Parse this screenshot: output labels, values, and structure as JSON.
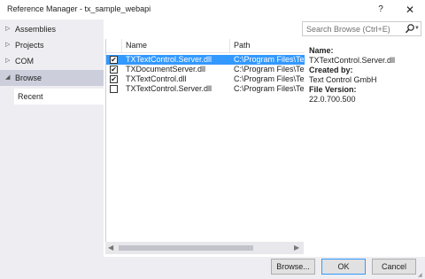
{
  "window": {
    "title": "Reference Manager - tx_sample_webapi",
    "help_label": "?",
    "close_label": "✕"
  },
  "sidebar": {
    "items": [
      {
        "label": "Assemblies",
        "arrow": "▷"
      },
      {
        "label": "Projects",
        "arrow": "▷"
      },
      {
        "label": "COM",
        "arrow": "▷"
      },
      {
        "label": "Browse",
        "arrow": "◢"
      }
    ],
    "subitems": [
      {
        "label": "Recent"
      }
    ]
  },
  "list": {
    "columns": [
      "Name",
      "Path"
    ],
    "rows": [
      {
        "checked": true,
        "name": "TXTextControl.Server.dll",
        "path": "C:\\Program Files\\Tex",
        "selected": true
      },
      {
        "checked": true,
        "name": "TXDocumentServer.dll",
        "path": "C:\\Program Files\\Tex",
        "selected": false
      },
      {
        "checked": true,
        "name": "TXTextControl.dll",
        "path": "C:\\Program Files\\Tex",
        "selected": false
      },
      {
        "checked": false,
        "name": "TXTextControl.Server.dll",
        "path": "C:\\Program Files\\Tex",
        "selected": false
      }
    ]
  },
  "search": {
    "placeholder": "Search Browse (Ctrl+E)",
    "icon": "search-icon"
  },
  "details": {
    "name_label": "Name:",
    "name_value": "TXTextControl.Server.dll",
    "created_label": "Created by:",
    "created_value": "Text Control GmbH",
    "version_label": "File Version:",
    "version_value": "22.0.700.500"
  },
  "footer": {
    "browse_label": "Browse...",
    "ok_label": "OK",
    "cancel_label": "Cancel"
  },
  "colors": {
    "selection": "#3399ff",
    "pane_bg": "#eeeef2",
    "nav_selected": "#cccedb"
  }
}
